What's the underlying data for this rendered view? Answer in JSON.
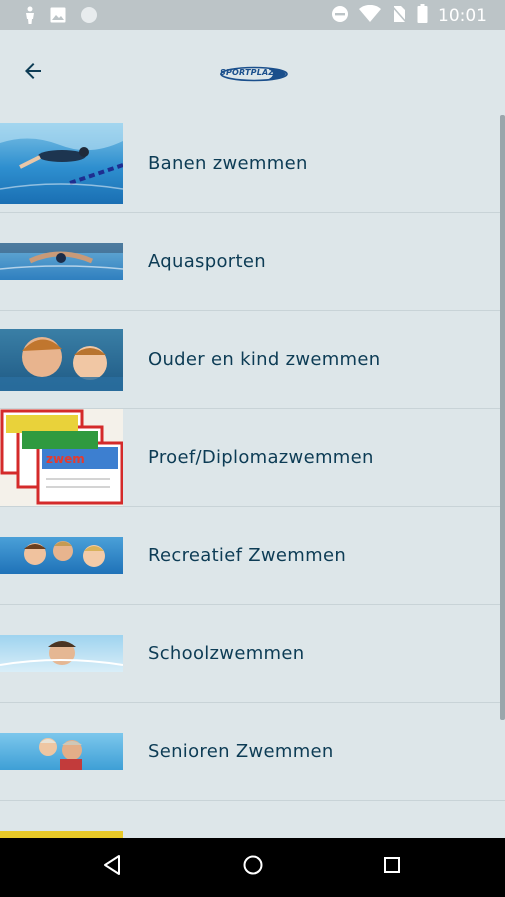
{
  "status_bar": {
    "time": "10:01",
    "left_icons": [
      "person-icon",
      "image-icon",
      "circle-icon"
    ],
    "right_icons": [
      "do-not-disturb-icon",
      "wifi-icon",
      "no-sim-icon",
      "battery-icon"
    ]
  },
  "app_bar": {
    "back_icon": "arrow-back-icon",
    "logo_text": "SPORTPLAZA"
  },
  "items": [
    {
      "label": "Banen zwemmen",
      "thumb": "banen"
    },
    {
      "label": "Aquasporten",
      "thumb": "aqua"
    },
    {
      "label": "Ouder en kind zwemmen",
      "thumb": "ouder"
    },
    {
      "label": "Proef/Diplomazwemmen",
      "thumb": "diploma"
    },
    {
      "label": "Recreatief Zwemmen",
      "thumb": "recreatief"
    },
    {
      "label": "Schoolzwemmen",
      "thumb": "school"
    },
    {
      "label": "Senioren Zwemmen",
      "thumb": "senioren"
    },
    {
      "label": "",
      "thumb": "partial"
    }
  ],
  "nav_bar": [
    "back-triangle-icon",
    "home-circle-icon",
    "recents-square-icon"
  ],
  "colors": {
    "background": "#dde6e9",
    "text": "#0d3c55",
    "status_bar": "#bcc4c7",
    "accent": "#1a4f8c"
  }
}
